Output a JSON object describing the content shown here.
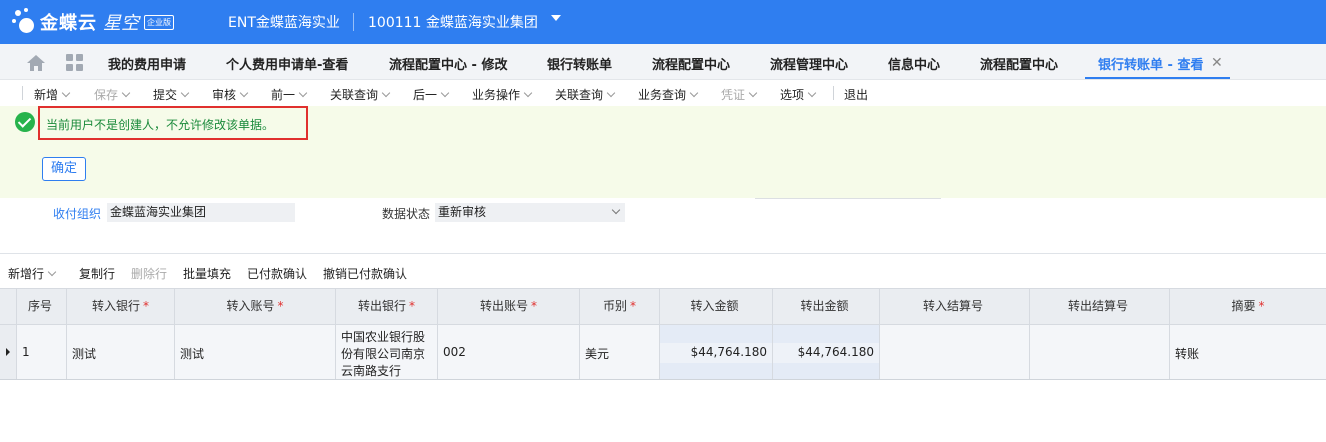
{
  "app": {
    "logo_text": "金蝶云",
    "logo_sub": "星空",
    "logo_badge": "企业版",
    "org_name": "ENT金蝶蓝海实业",
    "account": "100111  金蝶蓝海实业集团"
  },
  "tabs": [
    {
      "label": "我的费用申请"
    },
    {
      "label": "个人费用申请单-查看"
    },
    {
      "label": "流程配置中心 - 修改"
    },
    {
      "label": "银行转账单"
    },
    {
      "label": "流程配置中心"
    },
    {
      "label": "流程管理中心"
    },
    {
      "label": "信息中心"
    },
    {
      "label": "流程配置中心"
    },
    {
      "label": "银行转账单 - 查看"
    }
  ],
  "toolbar": [
    {
      "label": "新增"
    },
    {
      "label": "保存"
    },
    {
      "label": "提交"
    },
    {
      "label": "审核"
    },
    {
      "label": "前一"
    },
    {
      "label": "关联查询"
    },
    {
      "label": "后一"
    },
    {
      "label": "业务操作"
    },
    {
      "label": "关联查询"
    },
    {
      "label": "业务查询"
    },
    {
      "label": "凭证"
    },
    {
      "label": "选项"
    },
    {
      "label": "退出"
    }
  ],
  "message": {
    "text": "当前用户不是创建人，不允许修改该单据。",
    "confirm_label": "确定"
  },
  "form": {
    "org_label": "收付组织",
    "org_value": "金蝶蓝海实业集团",
    "status_label": "数据状态",
    "status_value": "重新审核"
  },
  "grid_toolbar": [
    {
      "label": "新增行"
    },
    {
      "label": "复制行"
    },
    {
      "label": "删除行"
    },
    {
      "label": "批量填充"
    },
    {
      "label": "已付款确认"
    },
    {
      "label": "撤销已付款确认"
    }
  ],
  "columns": [
    {
      "label": "序号",
      "required": ""
    },
    {
      "label": "转入银行",
      "required": "*"
    },
    {
      "label": "转入账号",
      "required": "*"
    },
    {
      "label": "转出银行",
      "required": "*"
    },
    {
      "label": "转出账号",
      "required": "*"
    },
    {
      "label": "币别",
      "required": "*"
    },
    {
      "label": "转入金额",
      "required": ""
    },
    {
      "label": "转出金额",
      "required": ""
    },
    {
      "label": "转入结算号",
      "required": ""
    },
    {
      "label": "转出结算号",
      "required": ""
    },
    {
      "label": "摘要",
      "required": "*"
    }
  ],
  "rows": [
    {
      "seq": "1",
      "in_bank": "测试",
      "in_account": "测试",
      "out_bank": "中国农业银行股份有限公司南京云南路支行",
      "out_account": "002",
      "currency": "美元",
      "in_amount": "$44,764.180",
      "out_amount": "$44,764.180",
      "in_settle": "",
      "out_settle": "",
      "summary": "转账"
    }
  ]
}
